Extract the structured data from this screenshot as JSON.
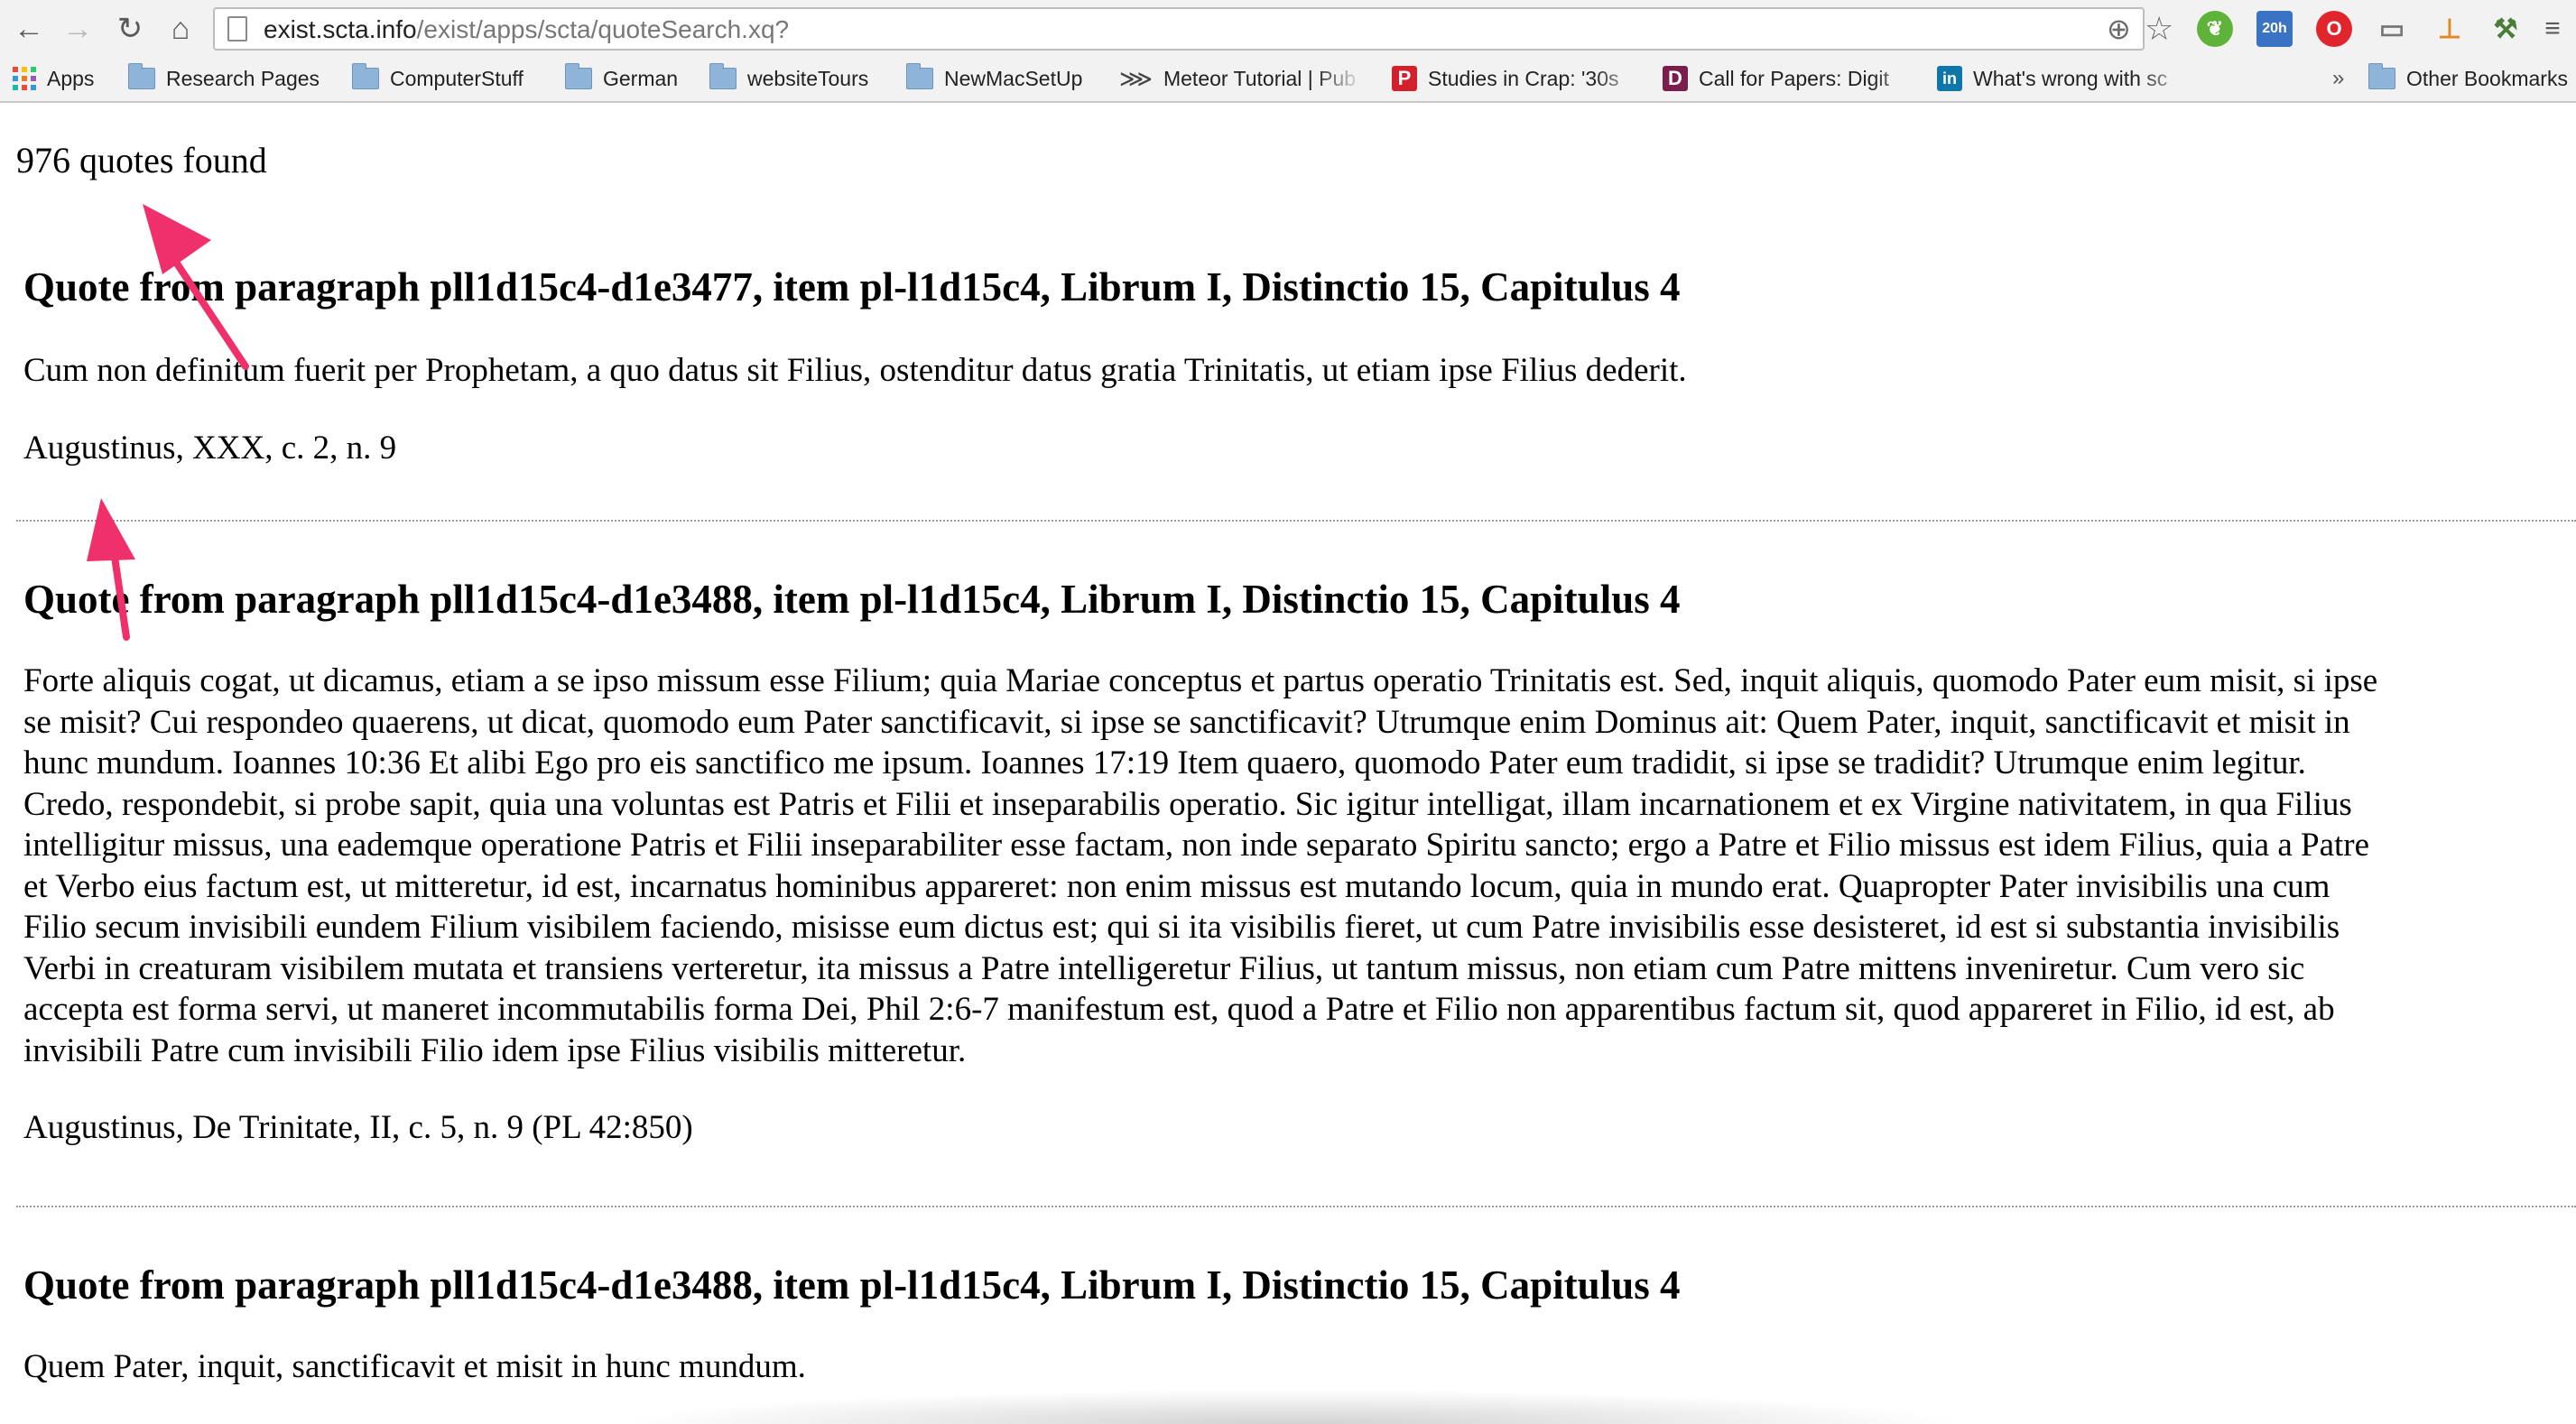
{
  "browser": {
    "url_host": "exist.scta.info",
    "url_path": "/exist/apps/scta/quoteSearch.xq?",
    "extensions": [
      {
        "name": "evernote-icon",
        "color": "#5fb33a",
        "glyph": "❦"
      },
      {
        "name": "calendar-icon",
        "color": "#3b73c4",
        "glyph": "20h"
      },
      {
        "name": "opera-icon",
        "color": "#e0262c",
        "glyph": "O"
      },
      {
        "name": "cast-icon",
        "color": "#777777",
        "glyph": "▭"
      },
      {
        "name": "tool-icon",
        "color": "#e08b1d",
        "glyph": "⊥"
      },
      {
        "name": "wand-icon",
        "color": "#4a7d3a",
        "glyph": "⚒"
      }
    ]
  },
  "bookmarks": {
    "items": [
      {
        "label": "Apps",
        "icon": "apps-grid-icon"
      },
      {
        "label": "Research Pages",
        "icon": "folder-icon"
      },
      {
        "label": "ComputerStuff",
        "icon": "folder-icon"
      },
      {
        "label": "German",
        "icon": "folder-icon"
      },
      {
        "label": "websiteTours",
        "icon": "folder-icon"
      },
      {
        "label": "NewMacSetUp",
        "icon": "folder-icon"
      },
      {
        "label": "Meteor Tutorial | Pub",
        "icon": "meteor-icon"
      },
      {
        "label": "Studies in Crap: '30s",
        "icon": "pinterest-icon"
      },
      {
        "label": "Call for Papers: Digit",
        "icon": "d-icon"
      },
      {
        "label": "What's wrong with sc",
        "icon": "linkedin-icon"
      }
    ],
    "overflow": "»",
    "other": "Other Bookmarks"
  },
  "page": {
    "count": "976 quotes found",
    "quotes": [
      {
        "heading": "Quote from paragraph pll1d15c4-d1e3477, item pl-l1d15c4, Librum I, Distinctio 15, Capitulus 4",
        "text": "Cum non definitum fuerit per Prophetam, a quo datus sit Filius, ostenditur datus gratia Trinitatis, ut etiam ipse Filius dederit.",
        "citation": "Augustinus, XXX, c. 2, n. 9"
      },
      {
        "heading": "Quote from paragraph pll1d15c4-d1e3488, item pl-l1d15c4, Librum I, Distinctio 15, Capitulus 4",
        "text": "Forte aliquis cogat, ut dicamus, etiam a se ipso missum esse Filium; quia Mariae conceptus et partus operatio Trinitatis est. Sed, inquit aliquis, quomodo Pater eum misit, si ipse\nse misit? Cui respondeo quaerens, ut dicat, quomodo eum Pater sanctificavit, si ipse se sanctificavit? Utrumque enim Dominus ait: Quem Pater, inquit, sanctificavit et misit in\nhunc mundum. Ioannes 10:36 Et alibi Ego pro eis sanctifico me ipsum. Ioannes 17:19 Item quaero, quomodo Pater eum tradidit, si ipse se tradidit? Utrumque enim legitur.\nCredo, respondebit, si probe sapit, quia una voluntas est Patris et Filii et inseparabilis operatio. Sic igitur intelligat, illam incarnationem et ex Virgine nativitatem, in qua Filius\nintelligitur missus, una eademque operatione Patris et Filii inseparabiliter esse factam, non inde separato Spiritu sancto; ergo a Patre et Filio missus est idem Filius, quia a Patre\net Verbo eius factum est, ut mitteretur, id est, incarnatus hominibus appareret: non enim missus est mutando locum, quia in mundo erat. Quapropter Pater invisibilis una cum\nFilio secum invisibili eundem Filium visibilem faciendo, misisse eum dictus est; qui si ita visibilis fieret, ut cum Patre invisibilis esse desisteret, id est si substantia invisibilis\nVerbi in creaturam visibilem mutata et transiens verteretur, ita missus a Patre intelligeretur Filius, ut tantum missus, non etiam cum Patre mittens inveniretur. Cum vero sic\naccepta est forma servi, ut maneret incommutabilis forma Dei, Phil 2:6-7 manifestum est, quod a Patre et Filio non apparentibus factum sit, quod appareret in Filio, id est, ab\ninvisibili Patre cum invisibili Filio idem ipse Filius visibilis mitteretur.",
        "citation": "Augustinus, De Trinitate, II, c. 5, n. 9 (PL 42:850)"
      },
      {
        "heading": "Quote from paragraph pll1d15c4-d1e3488, item pl-l1d15c4, Librum I, Distinctio 15, Capitulus 4",
        "text": "Quem Pater, inquit, sanctificavit et misit in hunc mundum.",
        "citation": ""
      }
    ]
  },
  "annotation_color": "#f0306a"
}
